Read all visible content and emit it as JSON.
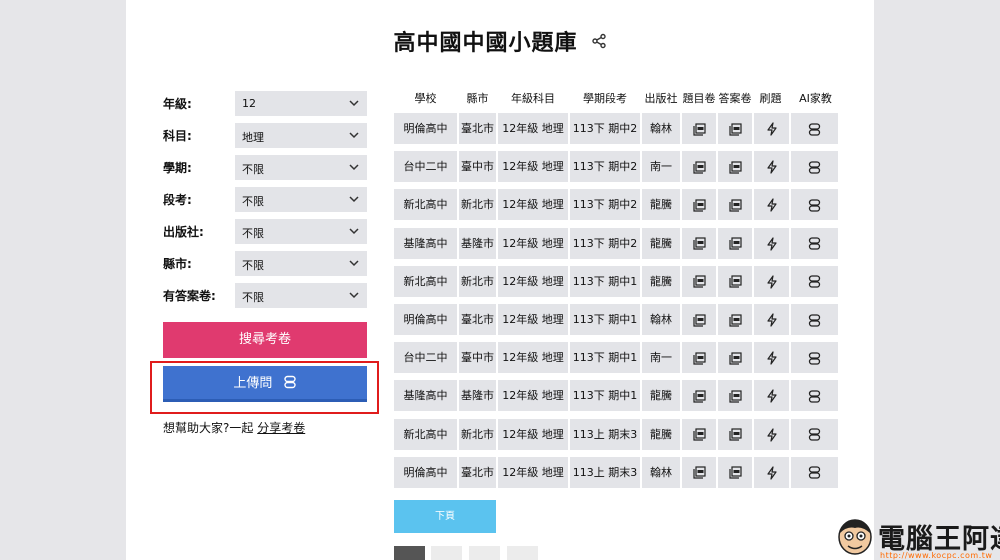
{
  "page_title": "高中國中國小題庫",
  "filters": [
    {
      "label": "年級:",
      "value": "12"
    },
    {
      "label": "科目:",
      "value": "地理"
    },
    {
      "label": "學期:",
      "value": "不限"
    },
    {
      "label": "段考:",
      "value": "不限"
    },
    {
      "label": "出版社:",
      "value": "不限"
    },
    {
      "label": "縣市:",
      "value": "不限"
    },
    {
      "label": "有答案卷:",
      "value": "不限"
    }
  ],
  "buttons": {
    "search": "搜尋考卷",
    "upload": "上傳問",
    "next": "下頁"
  },
  "help": {
    "text": "想幫助大家?一起",
    "link": "分享考卷"
  },
  "table": {
    "headers": [
      "學校",
      "縣市",
      "年級科目",
      "學期段考",
      "出版社",
      "題目卷",
      "答案卷",
      "刷題",
      "AI家教"
    ],
    "rows": [
      [
        "明倫高中",
        "臺北市",
        "12年級 地理",
        "113下 期中2",
        "翰林"
      ],
      [
        "台中二中",
        "臺中市",
        "12年級 地理",
        "113下 期中2",
        "南一"
      ],
      [
        "新北高中",
        "新北市",
        "12年級 地理",
        "113下 期中2",
        "龍騰"
      ],
      [
        "基隆高中",
        "基隆市",
        "12年級 地理",
        "113下 期中2",
        "龍騰"
      ],
      [
        "新北高中",
        "新北市",
        "12年級 地理",
        "113下 期中1",
        "龍騰"
      ],
      [
        "明倫高中",
        "臺北市",
        "12年級 地理",
        "113下 期中1",
        "翰林"
      ],
      [
        "台中二中",
        "臺中市",
        "12年級 地理",
        "113下 期中1",
        "南一"
      ],
      [
        "基隆高中",
        "基隆市",
        "12年級 地理",
        "113下 期中1",
        "龍騰"
      ],
      [
        "新北高中",
        "新北市",
        "12年級 地理",
        "113上 期末3",
        "龍騰"
      ],
      [
        "明倫高中",
        "臺北市",
        "12年級 地理",
        "113上 期末3",
        "翰林"
      ]
    ]
  },
  "icons": {
    "share": "share-icon",
    "question_pdf": "pdf-icon",
    "answer_pdf": "pdf-icon",
    "practice": "lightning-icon",
    "ai_tutor": "robot-icon"
  },
  "watermark": {
    "text": "電腦王阿達",
    "url": "http://www.kocpc.com.tw"
  },
  "colors": {
    "search_button": "#e03a6f",
    "upload_button": "#3f72cf",
    "next_button": "#5bc3ef",
    "highlight_frame": "#e01c1c",
    "cell_background": "#e3e4e8"
  }
}
